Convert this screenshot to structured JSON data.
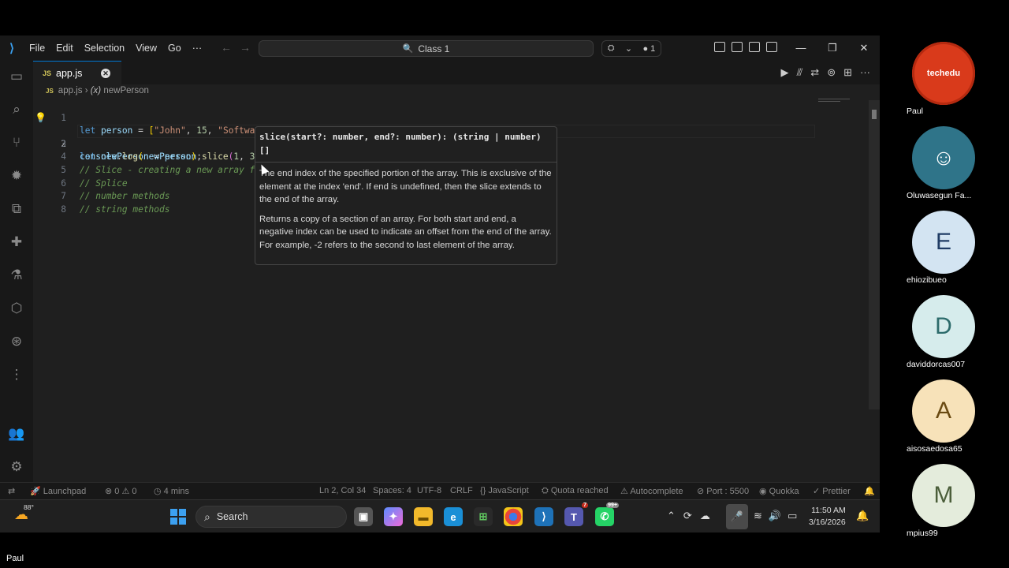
{
  "titlebar": {
    "menus": [
      "File",
      "Edit",
      "Selection",
      "View",
      "Go",
      "···"
    ],
    "command_center": "Class 1",
    "copilot_count": "1"
  },
  "tabs": [
    {
      "label": "app.js",
      "lang": "JS"
    }
  ],
  "breadcrumb": {
    "file": "app.js",
    "symbol_prefix": "(x)",
    "symbol": "newPerson"
  },
  "editor": {
    "line_numbers": [
      "1",
      "2",
      "3",
      "4",
      "5",
      "6",
      "7",
      "8"
    ],
    "comments": [
      "// Slice - creating a new array f",
      "// Splice",
      "// number methods",
      "// string methods"
    ]
  },
  "hover": {
    "signature_line1": "slice(start?: number, end?: number): (string | number)",
    "signature_line2": "[]",
    "para1": "The end index of the specified portion of the array. This is exclusive of the element at the index 'end'. If end is undefined, then the slice extends to the end of the array.",
    "para2": "Returns a copy of a section of an array. For both start and end, a negative index can be used to indicate an offset from the end of the array. For example, -2 refers to the second to last element of the array."
  },
  "statusbar": {
    "launchpad": "Launchpad",
    "errors": "0",
    "warnings": "0",
    "time": "4 mins",
    "position": "Ln 2, Col 34",
    "spaces": "Spaces: 4",
    "encoding": "UTF-8",
    "eol": "CRLF",
    "language": "JavaScript",
    "quota": "Quota reached",
    "autocomplete": "Autocomplete",
    "port": "Port : 5500",
    "quokka": "Quokka",
    "prettier": "Prettier"
  },
  "taskbar": {
    "temperature": "88°",
    "search": "Search",
    "teams_badge": "7",
    "whatsapp_badge": "99+",
    "time": "11:50 AM",
    "date": "3/16/2026"
  },
  "participants": [
    {
      "name": "Paul",
      "initial": "techedu",
      "bg": "#d93a1b",
      "fg": "#ffffff"
    },
    {
      "name": "Oluwasegun Fa...",
      "initial": "",
      "bg": "#2f7489",
      "fg": "#ffffff"
    },
    {
      "name": "ehiozibueo",
      "initial": "E",
      "bg": "#d3e4f2",
      "fg": "#1f3b64"
    },
    {
      "name": "daviddorcas007",
      "initial": "D",
      "bg": "#d6ecec",
      "fg": "#2c6b6b"
    },
    {
      "name": "aisosaedosa65",
      "initial": "A",
      "bg": "#f7e2b9",
      "fg": "#6a4a12"
    },
    {
      "name": "mpius99",
      "initial": "M",
      "bg": "#e4ecdc",
      "fg": "#4b5e3a"
    }
  ],
  "bottom_name": "Paul"
}
